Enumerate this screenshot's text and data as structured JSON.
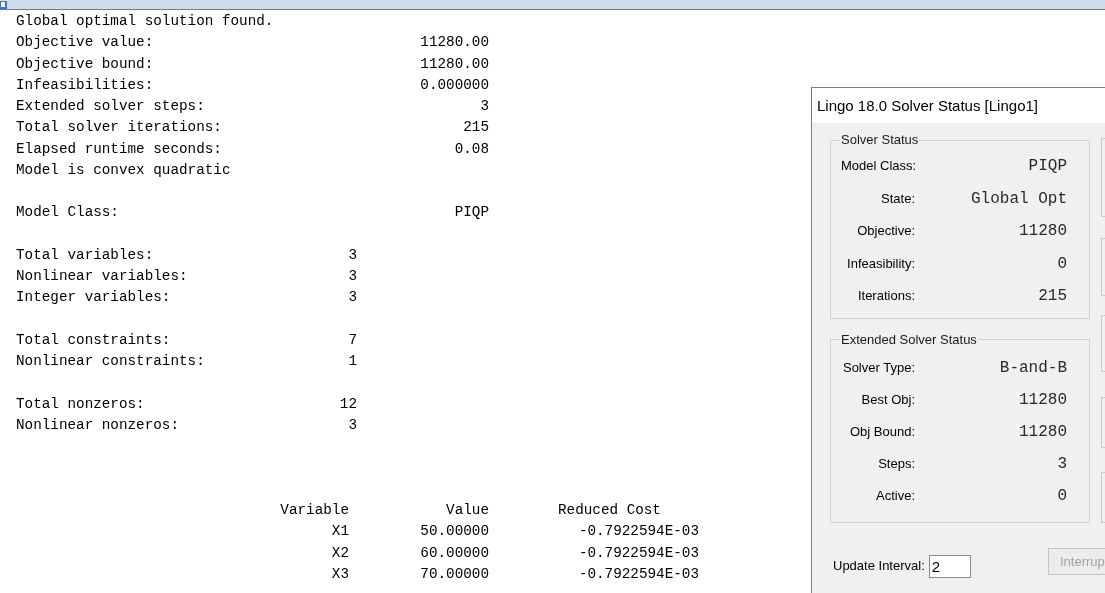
{
  "report": {
    "status_line": "Global optimal solution found.",
    "summary": [
      {
        "label": "Objective value:",
        "value": "11280.00"
      },
      {
        "label": "Objective bound:",
        "value": "11280.00"
      },
      {
        "label": "Infeasibilities:",
        "value": "0.000000"
      },
      {
        "label": "Extended solver steps:",
        "value": "3"
      },
      {
        "label": "Total solver iterations:",
        "value": "215"
      },
      {
        "label": "Elapsed runtime seconds:",
        "value": "0.08"
      }
    ],
    "model_note": "Model is convex quadratic",
    "model_class": {
      "label": "Model Class:",
      "value": "PIQP"
    },
    "count_groups": [
      [
        {
          "label": "Total variables:",
          "value": "3"
        },
        {
          "label": "Nonlinear variables:",
          "value": "3"
        },
        {
          "label": "Integer variables:",
          "value": "3"
        }
      ],
      [
        {
          "label": "Total constraints:",
          "value": "7"
        },
        {
          "label": "Nonlinear constraints:",
          "value": "1"
        }
      ],
      [
        {
          "label": "Total nonzeros:",
          "value": "12"
        },
        {
          "label": "Nonlinear nonzeros:",
          "value": "3"
        }
      ]
    ],
    "variables_table": {
      "columns": [
        "Variable",
        "Value",
        "Reduced Cost"
      ],
      "rows": [
        [
          "X1",
          "50.00000",
          "-0.7922594E-03"
        ],
        [
          "X2",
          "60.00000",
          "-0.7922594E-03"
        ],
        [
          "X3",
          "70.00000",
          "-0.7922594E-03"
        ]
      ]
    }
  },
  "solver_dialog": {
    "title": "Lingo 18.0 Solver Status [Lingo1]",
    "groups": [
      {
        "title": "Solver Status",
        "fields": [
          {
            "label": "Model Class:",
            "value": "PIQP"
          },
          {
            "label": "State:",
            "value": "Global Opt"
          },
          {
            "label": "Objective:",
            "value": "11280"
          },
          {
            "label": "Infeasibility:",
            "value": "0"
          },
          {
            "label": "Iterations:",
            "value": "215"
          }
        ]
      },
      {
        "title": "Extended Solver Status",
        "fields": [
          {
            "label": "Solver Type:",
            "value": "B-and-B"
          },
          {
            "label": "Best Obj:",
            "value": "11280"
          },
          {
            "label": "Obj Bound:",
            "value": "11280"
          },
          {
            "label": "Steps:",
            "value": "3"
          },
          {
            "label": "Active:",
            "value": "0"
          }
        ]
      }
    ],
    "update_interval": {
      "label": "Update Interval:",
      "value": "2"
    },
    "interrupt_button": {
      "label": "Interrup",
      "disabled": true
    }
  }
}
